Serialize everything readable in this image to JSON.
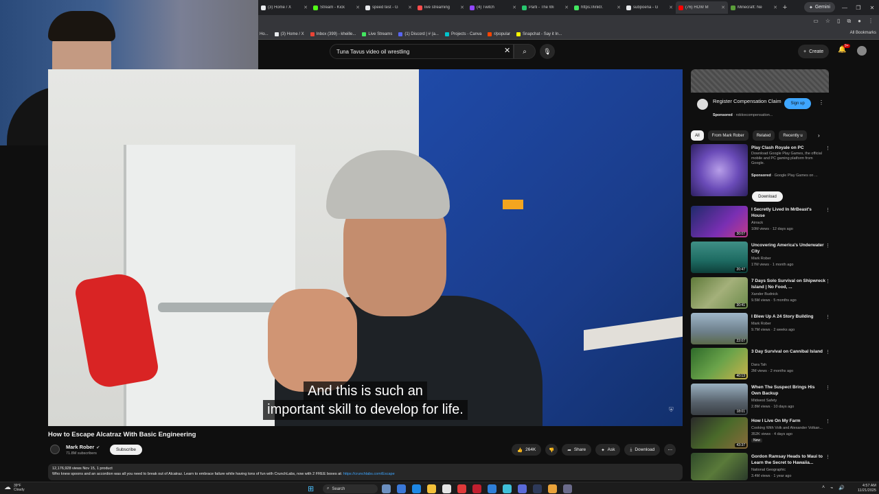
{
  "browser": {
    "tabs": [
      {
        "label": "(3) Home / X",
        "color": "#e8eaed"
      },
      {
        "label": "Stream - Kick",
        "color": "#53fc18"
      },
      {
        "label": "speed test - G",
        "color": "#e8eaed"
      },
      {
        "label": "live streaming",
        "color": "#ff4d4d"
      },
      {
        "label": "(4) Twitch",
        "color": "#9146ff"
      },
      {
        "label": "Parti - The Wi",
        "color": "#28c76f"
      },
      {
        "label": "https://linktr.",
        "color": "#43e660"
      },
      {
        "label": "subpoena - G",
        "color": "#e8eaed"
      },
      {
        "label": "(76) HOW M",
        "color": "#ff0000"
      },
      {
        "label": "Minecraft: Ne",
        "color": "#5b9e3a"
      }
    ],
    "gemini_label": "Gemini",
    "bookmarks": [
      {
        "label": "Ho...",
        "color": "#e8eaed"
      },
      {
        "label": "(3) Home / X",
        "color": "#e8eaed"
      },
      {
        "label": "Inbox (399) - kheille...",
        "color": "#ea4335"
      },
      {
        "label": "Live Streams",
        "color": "#43e660"
      },
      {
        "label": "(1) Discord | # (a...",
        "color": "#5865f2"
      },
      {
        "label": "Projects - Canva",
        "color": "#00c4cc"
      },
      {
        "label": "r/popular",
        "color": "#ff4500"
      },
      {
        "label": "Snapchat - Say it In...",
        "color": "#fffc00"
      }
    ],
    "all_bookmarks": "All Bookmarks"
  },
  "youtube": {
    "search_value": "Tuna Tavus video oil wrestling",
    "create_label": "Create",
    "notif_count": "9+"
  },
  "video": {
    "caption_line1": "And this is such an",
    "caption_line2": "important skill to develop for life.",
    "title": "How to Escape Alcatraz With Basic Engineering",
    "channel": "Mark Rober",
    "subscribers": "71.8M subscribers",
    "subscribe_label": "Subscribe",
    "likes": "264K",
    "share_label": "Share",
    "ask_label": "Ask",
    "download_label": "Download",
    "desc_meta": "12,176,928 views  Nov 15,   1 product",
    "desc_text": "Who knew spoons and an accordion was all you need to break out of Alcatraz. Learn to embrace failure while having tons of fun with CrunchLabs, now with 2 FREE boxes at: ",
    "desc_link": "https://crunchlabs.com/Escape"
  },
  "sidebar": {
    "ad": {
      "title": "Register Compensation Claim",
      "sponsored": "Sponsored",
      "domain": "robloxcompensation...",
      "signup_label": "Sign up"
    },
    "chips": [
      "All",
      "From Mark Rober",
      "Related",
      "Recently u"
    ],
    "promo": {
      "title": "Play Clash Royale on PC",
      "desc": "Download Google Play Games, the official mobile and PC gaming platform from Google.",
      "sponsored": "Sponsored",
      "sponsor_name": "Google Play Games on ...",
      "download_label": "Download"
    },
    "videos": [
      {
        "title": "I Secretly Lived In MrBeast's House",
        "channel": "Airrack",
        "meta": "10M views · 12 days ago",
        "duration": "30:07",
        "badge": ""
      },
      {
        "title": "Uncovering America's Underwater City",
        "channel": "Mark Rober",
        "meta": "17M views · 1 month ago",
        "duration": "20:47",
        "badge": ""
      },
      {
        "title": "7 Days Solo Survival on Shipwreck Island | No Food, ...",
        "channel": "Xander Budnick",
        "meta": "9.5M views · 5 months ago",
        "duration": "30:41",
        "badge": ""
      },
      {
        "title": "I Blew Up A 24 Story Building",
        "channel": "Mark Rober",
        "meta": "9.7M views · 2 weeks ago",
        "duration": "22:07",
        "badge": ""
      },
      {
        "title": "3 Day Survival on Cannibal Island",
        "channel": "Dara Tah",
        "meta": "2M views · 2 months ago",
        "duration": "40:13",
        "badge": ""
      },
      {
        "title": "When The Suspect Brings His Own Backup",
        "channel": "Midwest Safety",
        "meta": "2.8M views · 10 days ago",
        "duration": "18:01",
        "badge": ""
      },
      {
        "title": "How I Live On My Farm",
        "channel": "Cooking With Volk and Alexander Volkan...",
        "meta": "352K views · 4 days ago",
        "duration": "43:37",
        "badge": "New"
      },
      {
        "title": "Gordon Ramsay Heads to Maui to Learn the Secret to Hawaiia...",
        "channel": "National Geographic",
        "meta": "3.4M views · 1 year ago",
        "duration": "",
        "badge": ""
      }
    ]
  },
  "taskbar": {
    "temp": "39°F",
    "weather": "Cloudy",
    "search_label": "Search",
    "time": "4:57 AM",
    "date": "11/21/2025"
  },
  "colors": {
    "accent": "#3ea6ff",
    "background": "#0f0f0f",
    "surface": "#272727"
  }
}
